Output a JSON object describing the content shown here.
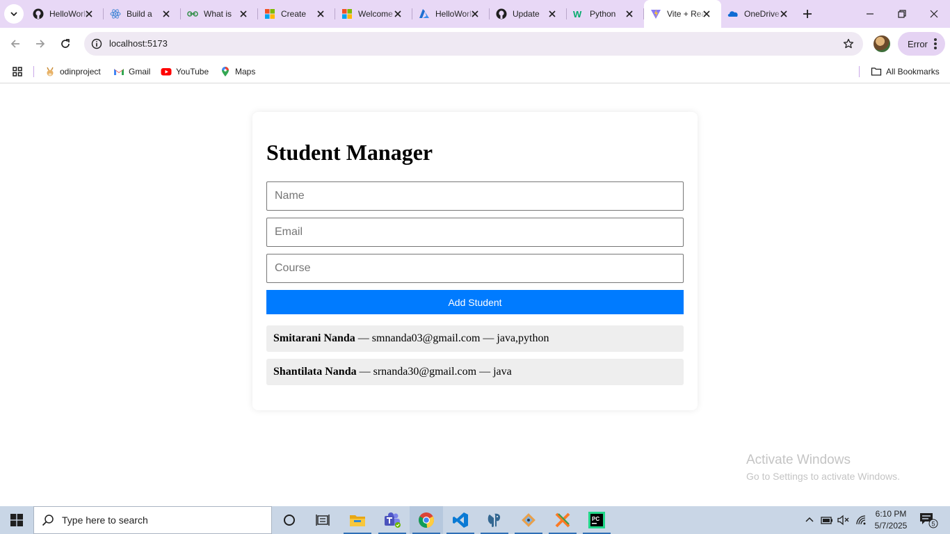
{
  "browser": {
    "tabs": [
      {
        "title": "HelloWorld",
        "icon": "github-icon"
      },
      {
        "title": "Build a",
        "icon": "react-icon"
      },
      {
        "title": "What is",
        "icon": "geeksforgeeks-icon"
      },
      {
        "title": "Create",
        "icon": "microsoft-icon"
      },
      {
        "title": "Welcome",
        "icon": "microsoft-icon"
      },
      {
        "title": "HelloWorld",
        "icon": "azure-icon"
      },
      {
        "title": "Update",
        "icon": "github-icon"
      },
      {
        "title": "Python",
        "icon": "w3schools-icon"
      },
      {
        "title": "Vite + React",
        "icon": "vite-icon",
        "active": true
      },
      {
        "title": "OneDrive",
        "icon": "onedrive-icon"
      }
    ],
    "address": "localhost:5173",
    "profile_status": "Error",
    "bookmarks": [
      {
        "label": "odinproject",
        "icon": "odinproject-icon"
      },
      {
        "label": "Gmail",
        "icon": "gmail-icon"
      },
      {
        "label": "YouTube",
        "icon": "youtube-icon"
      },
      {
        "label": "Maps",
        "icon": "maps-icon"
      }
    ],
    "all_bookmarks": "All Bookmarks"
  },
  "app": {
    "title": "Student Manager",
    "placeholders": {
      "name": "Name",
      "email": "Email",
      "course": "Course"
    },
    "add_button": "Add Student",
    "students": [
      {
        "name": "Smitarani Nanda",
        "email": "smnanda03@gmail.com",
        "course": "java,python"
      },
      {
        "name": "Shantilata Nanda",
        "email": "srnanda30@gmail.com",
        "course": "java"
      }
    ],
    "separator": " — "
  },
  "watermark": {
    "line1": "Activate Windows",
    "line2": "Go to Settings to activate Windows."
  },
  "taskbar": {
    "search_placeholder": "Type here to search",
    "time": "6:10 PM",
    "date": "5/7/2025",
    "notification_count": "5"
  }
}
